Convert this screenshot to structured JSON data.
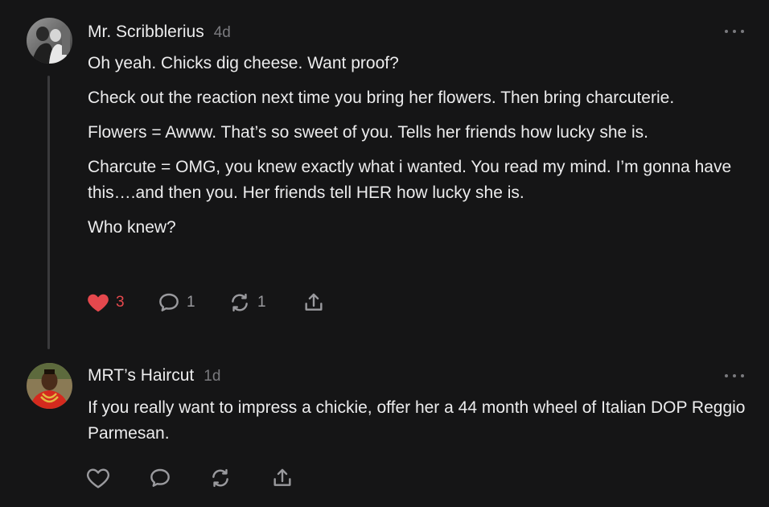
{
  "comments": [
    {
      "author": "Mr. Scribblerius",
      "time": "4d",
      "paragraphs": [
        "Oh yeah. Chicks dig cheese. Want proof?",
        "Check out the reaction next time you bring her flowers. Then bring charcuterie.",
        "Flowers = Awww. That’s so sweet of you. Tells her friends how lucky she is.",
        "Charcute = OMG, you knew exactly what i wanted. You read my mind. I’m gonna have this….and then you. Her friends tell HER how lucky she is.",
        "Who knew?"
      ],
      "likes": "3",
      "replies": "1",
      "restacks": "1",
      "liked": true
    },
    {
      "author": "MRT’s Haircut",
      "time": "1d",
      "paragraphs": [
        "If you really want to impress a chickie, offer her a 44 month wheel of Italian DOP Reggio Parmesan."
      ],
      "liked": false
    }
  ],
  "colors": {
    "background": "#151516",
    "like_red": "#e5484d",
    "muted": "#7a7a7e"
  },
  "icons": [
    "heart-icon",
    "comment-bubble-icon",
    "restack-icon",
    "share-icon",
    "more-options-icon"
  ]
}
